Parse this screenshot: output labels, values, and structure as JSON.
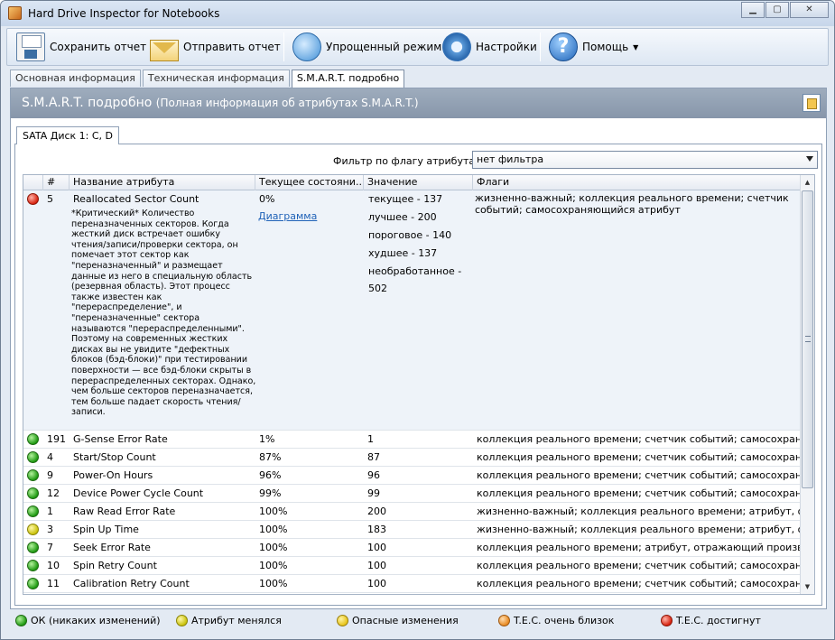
{
  "window": {
    "title": "Hard Drive Inspector for Notebooks"
  },
  "toolbar": {
    "save": "Сохранить отчет",
    "send": "Отправить отчет",
    "simple": "Упрощенный режим",
    "settings": "Настройки",
    "help": "Помощь"
  },
  "tabs": [
    "Основная информация",
    "Техническая информация",
    "S.M.A.R.T. подробно"
  ],
  "panel": {
    "title": "S.M.A.R.T. подробно",
    "subtitle": "(Полная информация об атрибутах S.M.A.R.T.)"
  },
  "disk_tab": "SATA Диск 1: C, D",
  "filter": {
    "label": "Фильтр по флагу атрибута:",
    "value": "нет фильтра"
  },
  "columns": [
    "#",
    "Название атрибута",
    "Текущее состояни...",
    "Значение",
    "Флаги"
  ],
  "expanded": {
    "status": "red",
    "num": "5",
    "name": "Reallocated Sector Count",
    "state": "0%",
    "diagram_link": "Диаграмма",
    "description": "*Критический* Количество переназначенных секторов. Когда жесткий диск встречает ошибку чтения/записи/проверки сектора, он помечает этот сектор как \"переназначенный\" и размещает данные из него в специальную область (резервная область). Этот процесс также известен как \"перераспределение\", и \"переназначенные\" сектора называются \"перераспределенными\". Поэтому на современных жестких дисках вы не увидите \"дефектных блоков (бэд-блоки)\" при тестировании поверхности — все бэд-блоки скрыты в перераспределенных секторах. Однако, чем больше секторов переназначается, тем больше падает скорость чтения/записи.",
    "values": [
      "текущее - 137",
      "лучшее - 200",
      "пороговое - 140",
      "худшее - 137",
      "необработанное - 502"
    ],
    "flags": "жизненно-важный; коллекция реального времени; счетчик событий; самосохраняющийся атрибут"
  },
  "rows": [
    {
      "status": "green",
      "num": "191",
      "name": "G-Sense Error Rate",
      "state": "1%",
      "value": "1",
      "flags": "коллекция реального времени; счетчик событий; самосохраняющ..."
    },
    {
      "status": "green",
      "num": "4",
      "name": "Start/Stop Count",
      "state": "87%",
      "value": "87",
      "flags": "коллекция реального времени; счетчик событий; самосохраняющ..."
    },
    {
      "status": "green",
      "num": "9",
      "name": "Power-On Hours",
      "state": "96%",
      "value": "96",
      "flags": "коллекция реального времени; счетчик событий; самосохраняющ..."
    },
    {
      "status": "green",
      "num": "12",
      "name": "Device Power Cycle Count",
      "state": "99%",
      "value": "99",
      "flags": "коллекция реального времени; счетчик событий; самосохраняющ..."
    },
    {
      "status": "green",
      "num": "1",
      "name": "Raw Read Error Rate",
      "state": "100%",
      "value": "200",
      "flags": "жизненно-важный; коллекция реального времени; атрибут, отража..."
    },
    {
      "status": "yellow",
      "num": "3",
      "name": "Spin Up Time",
      "state": "100%",
      "value": "183",
      "flags": "жизненно-важный; коллекция реального времени; атрибут, отража..."
    },
    {
      "status": "green",
      "num": "7",
      "name": "Seek Error Rate",
      "state": "100%",
      "value": "100",
      "flags": "коллекция реального времени; атрибут, отражающий производите..."
    },
    {
      "status": "green",
      "num": "10",
      "name": "Spin Retry Count",
      "state": "100%",
      "value": "100",
      "flags": "коллекция реального времени; счетчик событий; самосохраняющ..."
    },
    {
      "status": "green",
      "num": "11",
      "name": "Calibration Retry Count",
      "state": "100%",
      "value": "100",
      "flags": "коллекция реального времени; счетчик событий; самосохраняющ..."
    }
  ],
  "legend": [
    {
      "color": "green",
      "label": "ОК (никаких изменений)"
    },
    {
      "color": "yellow",
      "label": "Атрибут менялся"
    },
    {
      "color": "amber",
      "label": "Опасные изменения"
    },
    {
      "color": "orange",
      "label": "T.E.C. очень близок"
    },
    {
      "color": "red",
      "label": "T.E.C. достигнут"
    }
  ]
}
